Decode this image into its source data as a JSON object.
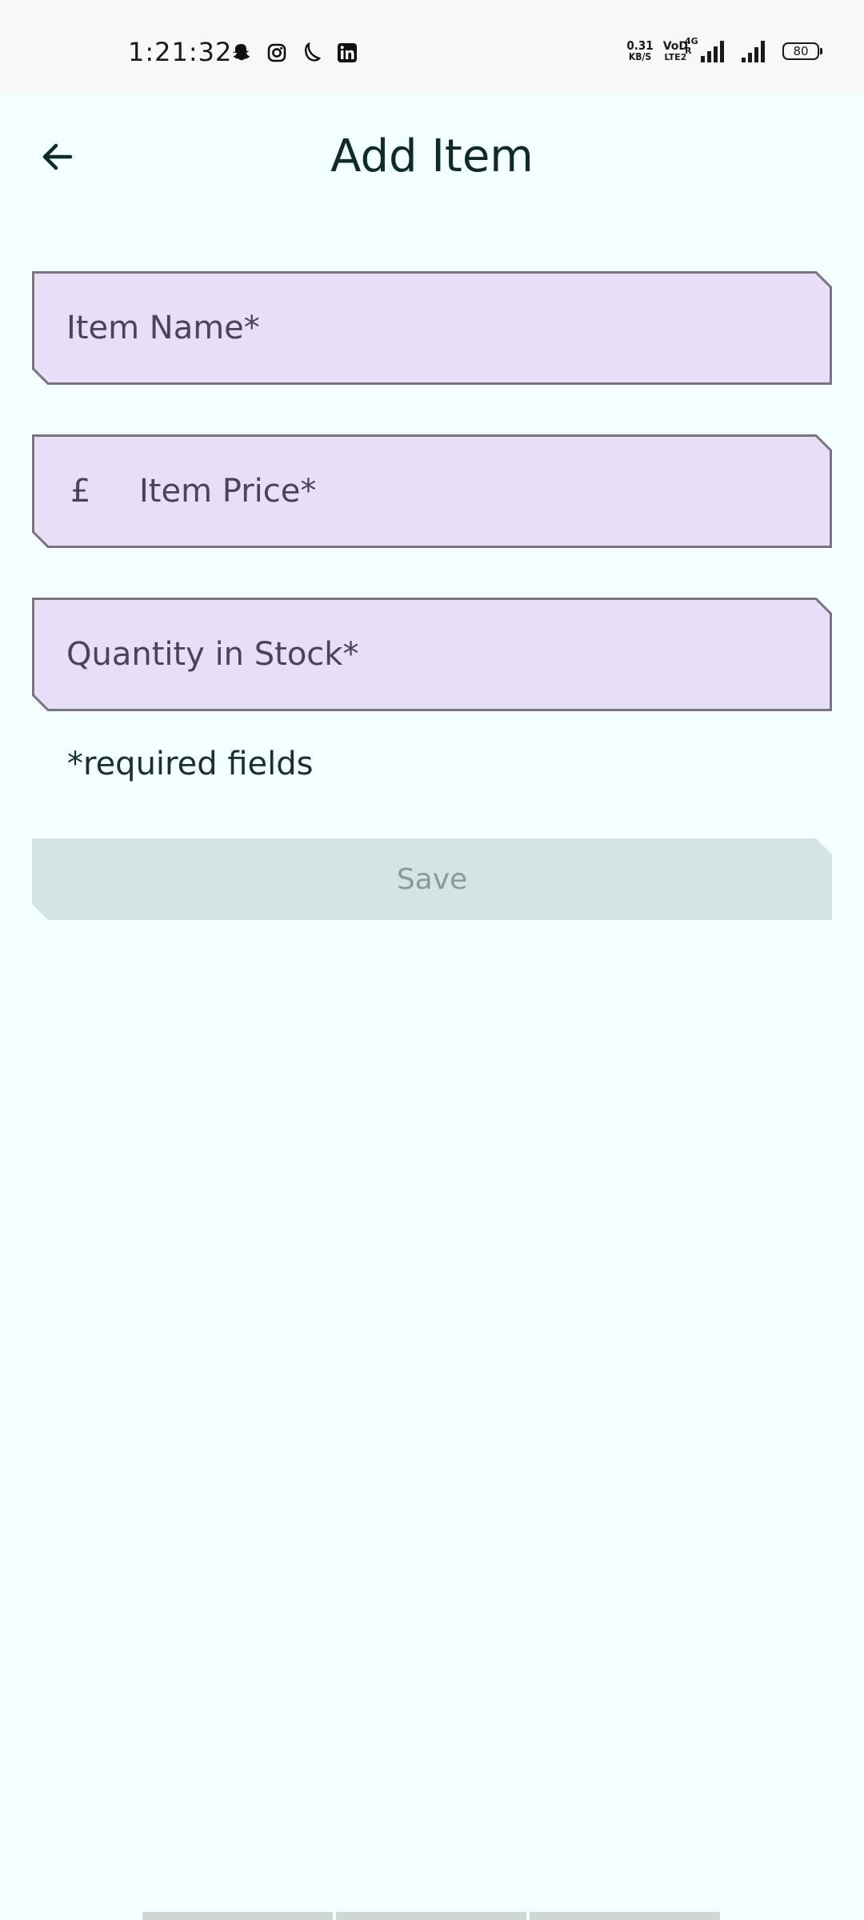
{
  "status_bar": {
    "time": "1:21:32",
    "net_speed_value": "0.31",
    "net_speed_unit": "KB/S",
    "volte_top": "VoD",
    "volte_bottom": "LTE2",
    "net_type": "4G",
    "net_sub": "R",
    "battery": "80",
    "notification_icons": [
      "snapchat-icon",
      "instagram-icon",
      "moon-icon",
      "linkedin-icon"
    ]
  },
  "header": {
    "title": "Add Item",
    "back_icon": "arrow-left-icon"
  },
  "form": {
    "item_name_label": "Item Name*",
    "item_price_prefix": "£",
    "item_price_label": "Item Price*",
    "quantity_label": "Quantity in Stock*",
    "required_note": "*required fields",
    "save_label": "Save"
  },
  "colors": {
    "background": "#f2fffe",
    "field_fill": "#e8def8",
    "field_border": "#79747e",
    "save_fill": "#d5e3e3",
    "save_text": "#8a9a9a"
  }
}
